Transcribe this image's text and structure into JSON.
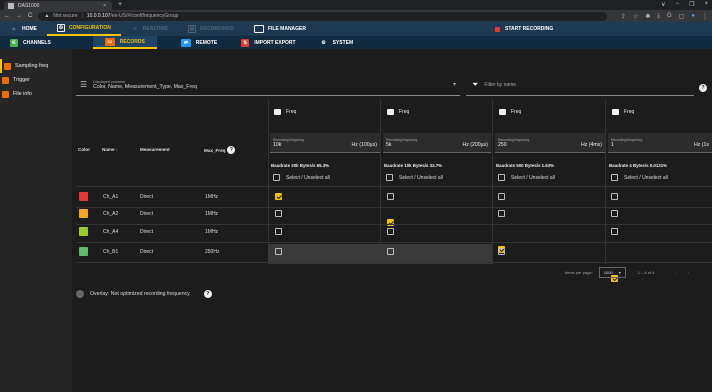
{
  "browser": {
    "tab_title": "DAS1000",
    "tab_close": "×",
    "new_tab": "+",
    "window_controls": [
      "∨",
      "−",
      "❐",
      "×"
    ],
    "url_warning": "Not secure",
    "url_host": "10.0.0.107",
    "url_path": "/en-US/#/conf/frequencyGroup",
    "nav": [
      "←",
      "→",
      "C"
    ]
  },
  "app_nav": {
    "items": [
      {
        "label": "HOME",
        "icon": "home-icon",
        "state": "normal"
      },
      {
        "label": "CONFIGURATION",
        "icon": "config-icon",
        "state": "active"
      },
      {
        "label": "REALTIME",
        "icon": "realtime-icon",
        "state": "disabled"
      },
      {
        "label": "RECORDINGS",
        "icon": "recordings-icon",
        "state": "disabled"
      },
      {
        "label": "FILE MANAGER",
        "icon": "folder-icon",
        "state": "normal"
      }
    ],
    "record_label": "START RECORDING"
  },
  "sub_nav": {
    "items": [
      {
        "label": "CHANNELS",
        "icon": "channels-icon",
        "color": "#4caf50",
        "state": "normal"
      },
      {
        "label": "RECORDS",
        "icon": "records-icon",
        "color": "#ef6c00",
        "state": "active"
      },
      {
        "label": "REMOTE",
        "icon": "remote-icon",
        "color": "#2196f3",
        "state": "normal"
      },
      {
        "label": "IMPORT EXPORT",
        "icon": "import-export-icon",
        "color": "#e53935",
        "state": "normal"
      },
      {
        "label": "SYSTEM",
        "icon": "system-icon",
        "color": "#ffffff",
        "state": "normal"
      }
    ]
  },
  "sidebar": {
    "items": [
      {
        "label": "Sampling freq",
        "state": "active"
      },
      {
        "label": "Trigger",
        "state": "normal"
      },
      {
        "label": "File info",
        "state": "normal"
      }
    ]
  },
  "columns_select": {
    "label": "Displayed columns",
    "value": "Color, Name, Measurement_Type, Max_Freq"
  },
  "filter": {
    "placeholder": "Filter by name"
  },
  "table": {
    "headers": {
      "color": "Color",
      "name": "Name ↑",
      "measurement": "Measurement",
      "max_freq": "Max_Freq"
    },
    "freq_groups": [
      {
        "title": "Freq",
        "rf_label": "Recording frequency",
        "value": "10k",
        "unit": "Hz (100µs)",
        "baudrate": "Baudrate 20k Bytes/s 65.3%",
        "select_all": "Select / Unselect all"
      },
      {
        "title": "Freq",
        "rf_label": "Recording frequency",
        "value": "5k",
        "unit": "Hz (200µs)",
        "baudrate": "Baudrate 10k Bytes/s 32.7%",
        "select_all": "Select / Unselect all"
      },
      {
        "title": "Freq",
        "rf_label": "Recording frequency",
        "value": "250",
        "unit": "Hz (4ms)",
        "baudrate": "Baudrate 500 Bytes/s 1.63%",
        "select_all": "Select / Unselect all"
      },
      {
        "title": "Freq",
        "rf_label": "Recording frequency",
        "value": "1",
        "unit": "Hz (1s",
        "baudrate": "Baudrate 4 Bytes/s 0.0131%",
        "select_all": "Select / Unselect all"
      }
    ],
    "rows": [
      {
        "color": "#e53935",
        "name": "Ch_A1",
        "measurement": "Direct",
        "max_freq": "1MHz",
        "checks": [
          true,
          false,
          false,
          false
        ]
      },
      {
        "color": "#f5a623",
        "name": "Ch_A2",
        "measurement": "Direct",
        "max_freq": "1MHz",
        "checks": [
          false,
          true,
          false,
          false
        ]
      },
      {
        "color": "#9ccc25",
        "name": "Ch_A4",
        "measurement": "Direct",
        "max_freq": "1MHz",
        "checks": [
          false,
          false,
          true,
          false
        ]
      },
      {
        "color": "#66bb6a",
        "name": "Ch_B1",
        "measurement": "Direct",
        "max_freq": "250Hz",
        "checks": [
          false,
          false,
          false,
          true
        ]
      }
    ]
  },
  "pager": {
    "label": "Items per page:",
    "value": "1000",
    "range": "1 – 4 of 4",
    "prev": "‹",
    "next": "›"
  },
  "overlay": {
    "label": "Overlay: Not optimized recording frequency"
  }
}
